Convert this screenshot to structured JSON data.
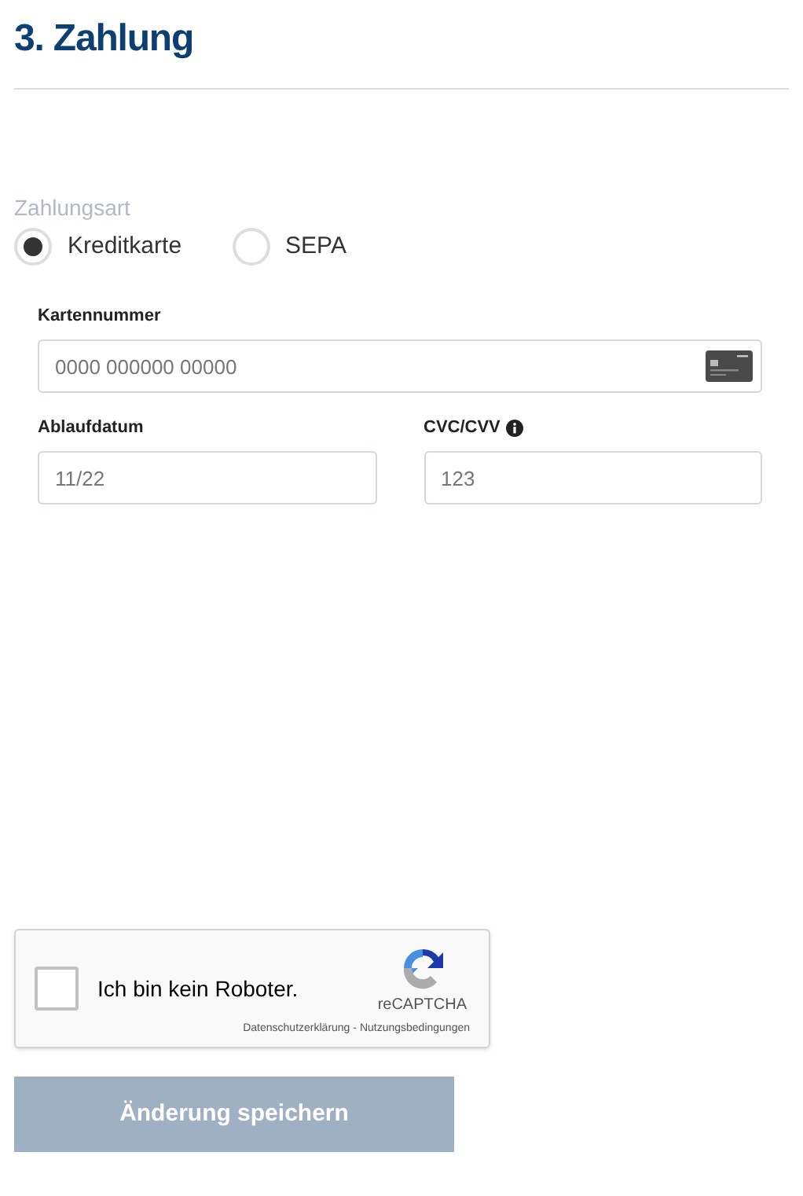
{
  "heading": "3. Zahlung",
  "payment_method": {
    "label": "Zahlungsart",
    "options": [
      {
        "label": "Kreditkarte",
        "selected": true
      },
      {
        "label": "SEPA",
        "selected": false
      }
    ]
  },
  "fields": [
    {
      "label": "Kartennummer",
      "placeholder": "0000 000000 00000",
      "kind": "card",
      "info": false
    },
    {
      "label": "Ablaufdatum",
      "placeholder": "11/22",
      "kind": "half",
      "info": false
    },
    {
      "label": "CVC/CVV",
      "placeholder": "123",
      "kind": "half",
      "info": true
    }
  ],
  "captcha": {
    "label": "Ich bin kein Roboter.",
    "checked": false,
    "brand": "reCAPTCHA",
    "links": [
      "Datenschutzerklärung",
      "Nutzungsbedingungen"
    ],
    "separator": "-"
  },
  "submit": {
    "label": "Änderung speichern",
    "disabled": true
  }
}
